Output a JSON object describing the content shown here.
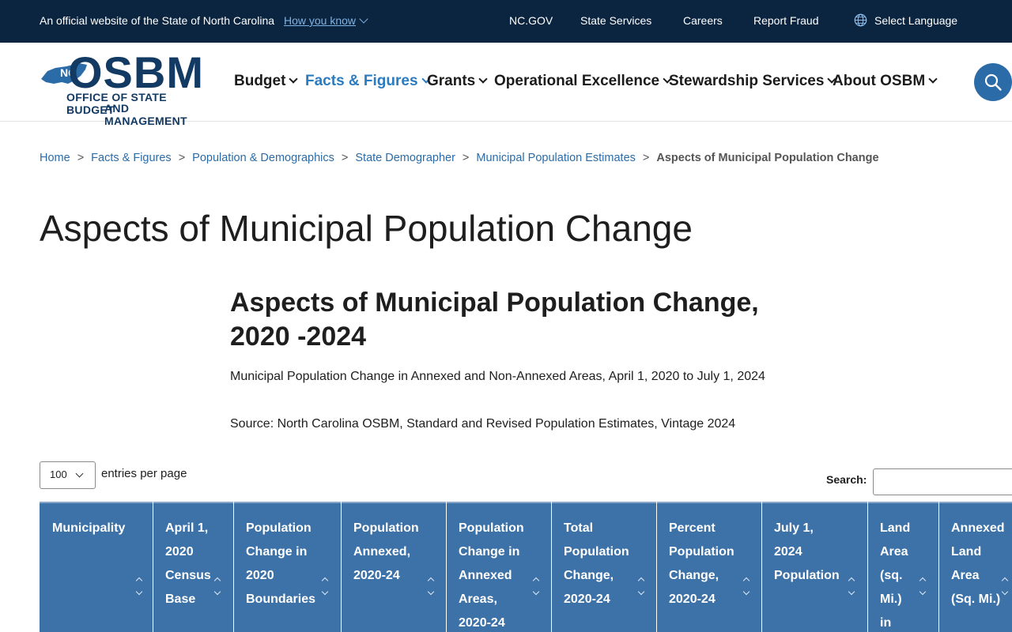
{
  "topbar": {
    "official_text": "An official website of the State of North Carolina",
    "how_you_know": "How you know",
    "links": [
      "NC.GOV",
      "State Services",
      "Careers",
      "Report Fraud"
    ],
    "language": "Select Language"
  },
  "logo": {
    "badge": "NC",
    "name": "OSBM",
    "sub1": "OFFICE OF STATE BUDGET",
    "sub2": "AND MANAGEMENT"
  },
  "nav": [
    {
      "label": "Budget",
      "active": false
    },
    {
      "label": "Facts & Figures",
      "active": true
    },
    {
      "label": "Grants",
      "active": false
    },
    {
      "label": "Operational Excellence",
      "active": false
    },
    {
      "label": "Stewardship Services",
      "active": false
    },
    {
      "label": "About OSBM",
      "active": false
    }
  ],
  "breadcrumb": {
    "items": [
      "Home",
      "Facts & Figures",
      "Population & Demographics",
      "State Demographer",
      "Municipal Population Estimates"
    ],
    "separator": ">",
    "current": "Aspects of Municipal Population Change"
  },
  "page_title": "Aspects of Municipal Population Change",
  "section": {
    "title": "Aspects of Municipal Population Change, 2020 -2024",
    "description": "Municipal Population Change in Annexed and Non-Annexed Areas,  April 1, 2020 to July 1, 2024",
    "source": "Source: North Carolina OSBM, Standard and Revised Population Estimates, Vintage 2024"
  },
  "table_controls": {
    "entries_value": "100",
    "entries_label": "entries per page",
    "search_label": "Search:",
    "search_value": ""
  },
  "table": {
    "columns": [
      [
        "Municipality"
      ],
      [
        "April 1,",
        "2020",
        "Census",
        "Base"
      ],
      [
        "Population",
        "Change in",
        "2020",
        "Boundaries"
      ],
      [
        "Population",
        "Annexed,",
        "2020-24"
      ],
      [
        "Population",
        "Change in",
        "Annexed",
        "Areas,",
        "2020-24"
      ],
      [
        "Total",
        "Population",
        "Change,",
        "2020-24"
      ],
      [
        "Percent",
        "Population",
        "Change,",
        "2020-24"
      ],
      [
        "July 1,",
        "2024",
        "Population"
      ],
      [
        "Land",
        "Area",
        "(sq.",
        "Mi.)",
        "in"
      ],
      [
        "Annexed",
        "Land",
        "Area",
        "(Sq. Mi.)"
      ]
    ]
  },
  "colors": {
    "topbar_bg": "#0b2540",
    "brand_navy": "#123a63",
    "link_blue": "#2b6ca8",
    "active_nav": "#2b7bc0",
    "table_header_bg": "#3d72a8"
  }
}
